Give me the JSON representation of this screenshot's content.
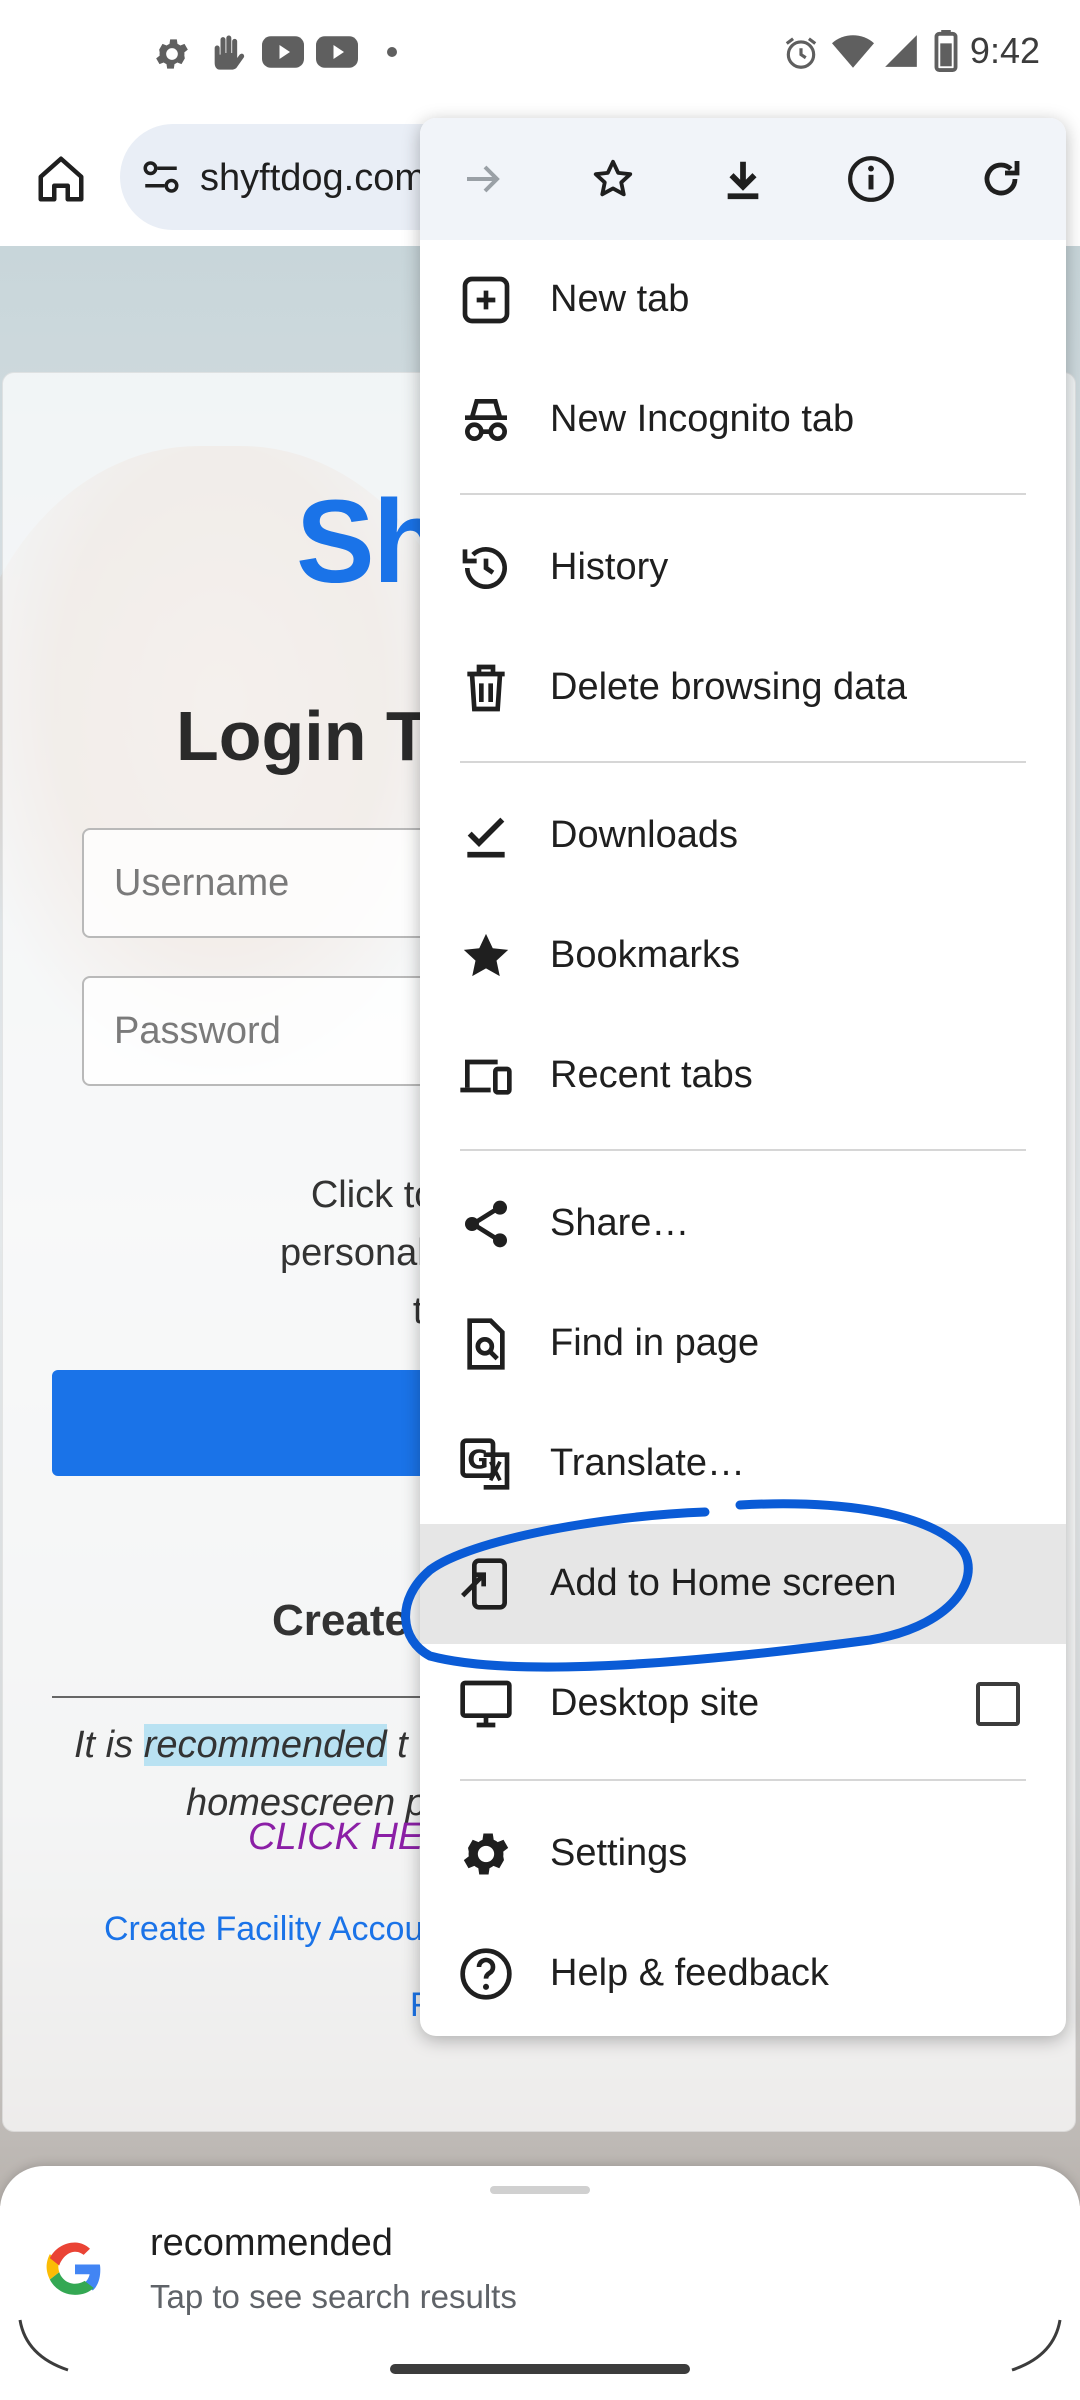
{
  "status_bar": {
    "time": "9:42",
    "left_icons": [
      "gear-icon",
      "hand-icon",
      "youtube-icon",
      "youtube-icon",
      "dot-icon"
    ],
    "right_icons": [
      "alarm-icon",
      "wifi-icon",
      "signal-icon",
      "battery-icon"
    ]
  },
  "toolbar": {
    "url": "shyftdog.com",
    "home_icon": "home-icon",
    "site_settings_icon": "tune-icon"
  },
  "menu": {
    "icon_row": [
      "forward-icon",
      "star-outline-icon",
      "download-icon",
      "info-icon",
      "refresh-icon"
    ],
    "items": [
      {
        "label": "New tab",
        "icon": "new-tab-icon"
      },
      {
        "label": "New Incognito tab",
        "icon": "incognito-icon"
      },
      {
        "label": "History",
        "icon": "history-icon"
      },
      {
        "label": "Delete browsing data",
        "icon": "trash-icon"
      },
      {
        "label": "Downloads",
        "icon": "download-check-icon"
      },
      {
        "label": "Bookmarks",
        "icon": "star-icon"
      },
      {
        "label": "Recent tabs",
        "icon": "devices-icon"
      },
      {
        "label": "Share…",
        "icon": "share-icon"
      },
      {
        "label": "Find in page",
        "icon": "find-icon"
      },
      {
        "label": "Translate…",
        "icon": "translate-icon"
      },
      {
        "label": "Add to Home screen",
        "icon": "add-to-home-icon",
        "highlighted": true
      },
      {
        "label": "Desktop site",
        "icon": "desktop-icon",
        "checkbox": false
      },
      {
        "label": "Settings",
        "icon": "gear-icon"
      },
      {
        "label": "Help & feedback",
        "icon": "help-icon"
      }
    ]
  },
  "page": {
    "logo": "Sh",
    "title": "Login To",
    "username_placeholder": "Username",
    "password_placeholder": "Password",
    "stay_line1": "Click to stay logge",
    "stay_line2": "personal devices). If",
    "stay_line3": "to login e",
    "create_heading": "Create",
    "rec_prefix": "It is ",
    "rec_highlight": "recommended",
    "rec_suffix": " t",
    "rec_line2": "homescreen p",
    "click_here": "CLICK HE",
    "facility_link": "Create Facility Accou",
    "small_link": "F"
  },
  "bottom_sheet": {
    "query": "recommended",
    "subtitle": "Tap to see search results"
  },
  "colors": {
    "accent": "#1a73e8",
    "annotation": "#0a5bd6",
    "menu_highlight": "#e6e6e6",
    "click_here": "#8b1fa6"
  }
}
